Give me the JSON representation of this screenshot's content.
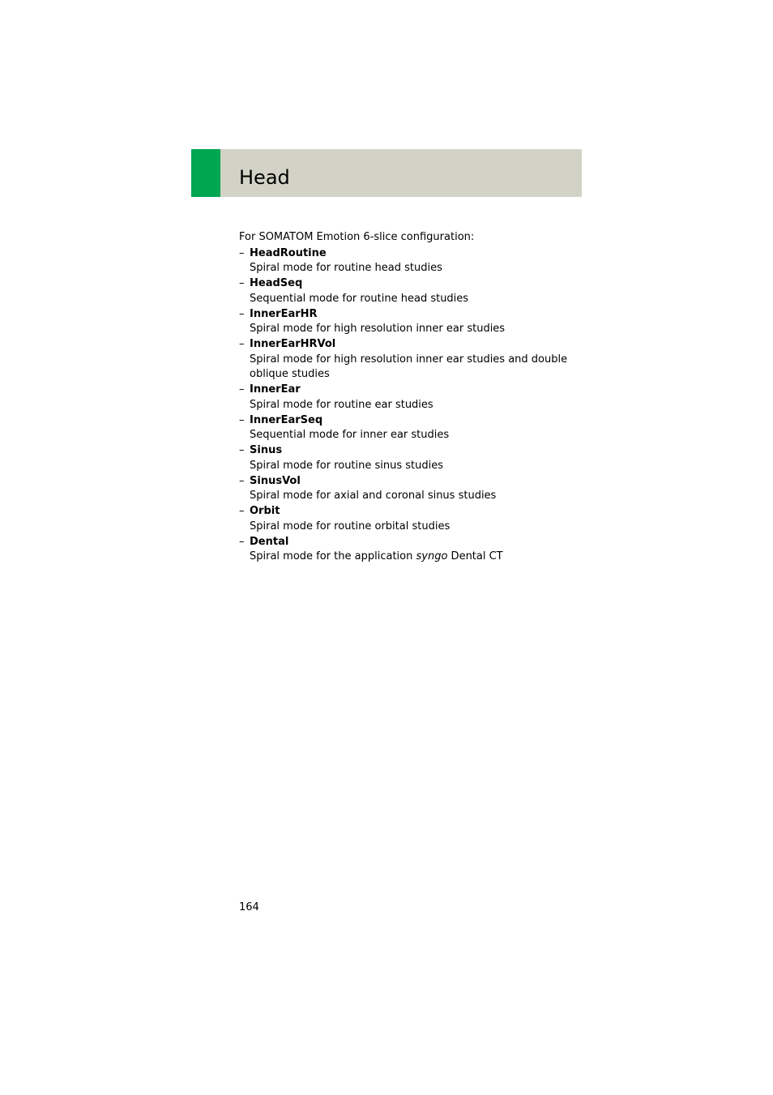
{
  "section": {
    "title": "Head",
    "accent_color": "#00a651",
    "band_color": "#d2d2c6"
  },
  "content": {
    "intro": "For SOMATOM Emotion 6-slice configuration:",
    "bullet": "–",
    "items": [
      {
        "name": "HeadRoutine",
        "desc": "Spiral mode for routine head studies"
      },
      {
        "name": "HeadSeq",
        "desc": "Sequential mode for routine head studies"
      },
      {
        "name": "InnerEarHR",
        "desc": "Spiral mode for high resolution inner ear studies"
      },
      {
        "name": "InnerEarHRVol",
        "desc": "Spiral mode for high resolution inner ear studies and double oblique studies"
      },
      {
        "name": "InnerEar",
        "desc": "Spiral mode for routine ear studies"
      },
      {
        "name": "InnerEarSeq",
        "desc": "Sequential mode for inner ear studies"
      },
      {
        "name": "Sinus",
        "desc": "Spiral mode for routine sinus studies"
      },
      {
        "name": "SinusVol",
        "desc": "Spiral mode for axial and coronal sinus studies"
      },
      {
        "name": "Orbit",
        "desc": "Spiral mode for routine orbital studies"
      },
      {
        "name": "Dental",
        "desc_pre": "Spiral mode for the application ",
        "desc_em": "syngo",
        "desc_post": " Dental CT"
      }
    ]
  },
  "footer": {
    "page_number": "164"
  }
}
